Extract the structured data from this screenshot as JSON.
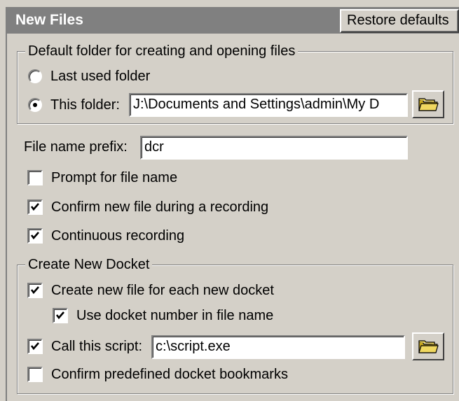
{
  "header": {
    "title": "New Files",
    "restore_label": "Restore defaults"
  },
  "default_folder": {
    "legend": "Default folder for creating and opening files",
    "option_last_used": "Last used folder",
    "option_this_folder": "This folder:",
    "selected": "this_folder",
    "folder_path": "J:\\Documents and Settings\\admin\\My D",
    "browse_icon": "folder-icon"
  },
  "file_name_prefix": {
    "label": "File name prefix:",
    "value": "dcr"
  },
  "options": {
    "prompt_file_name": {
      "label": "Prompt for file name",
      "checked": false
    },
    "confirm_new_file": {
      "label": "Confirm new file during a recording",
      "checked": true
    },
    "continuous_recording": {
      "label": "Continuous recording",
      "checked": true
    }
  },
  "docket": {
    "legend": "Create New Docket",
    "create_new_file": {
      "label": "Create new file for each new docket",
      "checked": true
    },
    "use_docket_number": {
      "label": "Use docket number in file name",
      "checked": true
    },
    "call_script": {
      "label": "Call this script:",
      "checked": true,
      "value": "c:\\script.exe"
    },
    "confirm_bookmarks": {
      "label": "Confirm predefined docket bookmarks",
      "checked": false
    },
    "browse_icon": "folder-icon"
  },
  "colors": {
    "face": "#d4d0c8",
    "header_bg": "#808080",
    "header_text": "#ffffff",
    "folder_icon": "#f0d860"
  }
}
